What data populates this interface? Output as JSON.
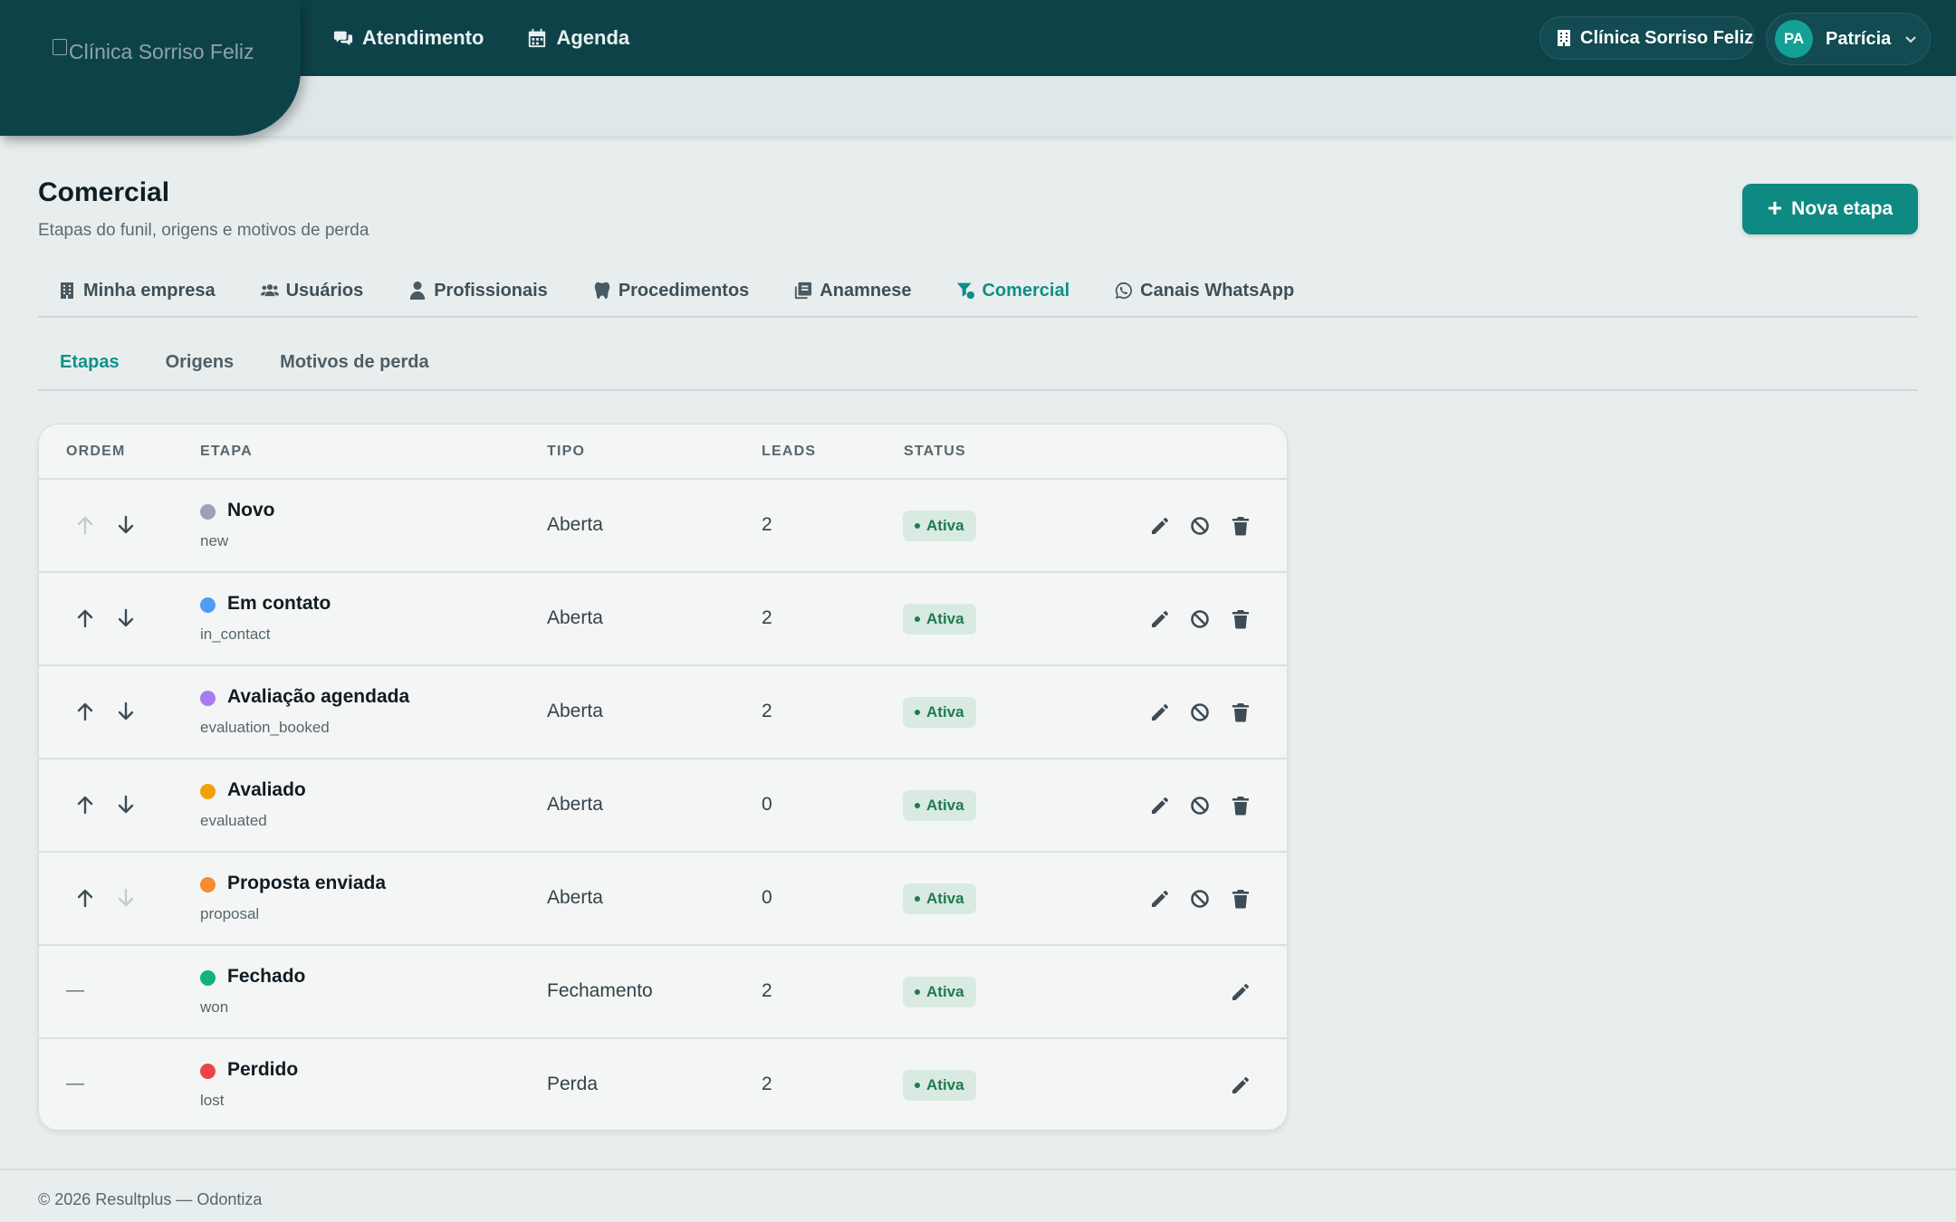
{
  "app": {
    "logo_alt": "Clínica Sorriso Feliz",
    "nav": [
      {
        "label": "Atendimento",
        "icon": "chat-bubbles-icon"
      },
      {
        "label": "Agenda",
        "icon": "calendar-icon"
      }
    ],
    "clinic_name": "Clínica Sorriso Feliz",
    "user": {
      "initials": "PA",
      "name": "Patrícia"
    }
  },
  "page": {
    "title": "Comercial",
    "subtitle": "Etapas do funil, origens e motivos de perda",
    "new_button_label": "Nova etapa"
  },
  "main_tabs": [
    {
      "label": "Minha empresa",
      "icon": "building-icon",
      "active": false
    },
    {
      "label": "Usuários",
      "icon": "users-icon",
      "active": false
    },
    {
      "label": "Profissionais",
      "icon": "doctor-icon",
      "active": false
    },
    {
      "label": "Procedimentos",
      "icon": "tooth-icon",
      "active": false
    },
    {
      "label": "Anamnese",
      "icon": "notes-icon",
      "active": false
    },
    {
      "label": "Comercial",
      "icon": "funnel-icon",
      "active": true
    },
    {
      "label": "Canais WhatsApp",
      "icon": "whatsapp-icon",
      "active": false
    }
  ],
  "sub_tabs": [
    {
      "label": "Etapas",
      "active": true
    },
    {
      "label": "Origens",
      "active": false
    },
    {
      "label": "Motivos de perda",
      "active": false
    }
  ],
  "table": {
    "headers": {
      "ordem": "ORDEM",
      "etapa": "ETAPA",
      "tipo": "TIPO",
      "leads": "LEADS",
      "status": "STATUS"
    },
    "rows": [
      {
        "name": "Novo",
        "key": "new",
        "color": "#9aa3b2",
        "tipo": "Aberta",
        "leads": "2",
        "status": "Ativa",
        "movable": true,
        "can_up": false,
        "can_down": true,
        "deletable": true
      },
      {
        "name": "Em contato",
        "key": "in_contact",
        "color": "#4f9cf5",
        "tipo": "Aberta",
        "leads": "2",
        "status": "Ativa",
        "movable": true,
        "can_up": true,
        "can_down": true,
        "deletable": true
      },
      {
        "name": "Avaliação agendada",
        "key": "evaluation_booked",
        "color": "#a77bf3",
        "tipo": "Aberta",
        "leads": "2",
        "status": "Ativa",
        "movable": true,
        "can_up": true,
        "can_down": true,
        "deletable": true
      },
      {
        "name": "Avaliado",
        "key": "evaluated",
        "color": "#f0a00c",
        "tipo": "Aberta",
        "leads": "0",
        "status": "Ativa",
        "movable": true,
        "can_up": true,
        "can_down": true,
        "deletable": true
      },
      {
        "name": "Proposta enviada",
        "key": "proposal",
        "color": "#f68c2e",
        "tipo": "Aberta",
        "leads": "0",
        "status": "Ativa",
        "movable": true,
        "can_up": true,
        "can_down": false,
        "deletable": true
      },
      {
        "name": "Fechado",
        "key": "won",
        "color": "#10b37c",
        "tipo": "Fechamento",
        "leads": "2",
        "status": "Ativa",
        "movable": false,
        "order_placeholder": "—",
        "deletable": false
      },
      {
        "name": "Perdido",
        "key": "lost",
        "color": "#ee4444",
        "tipo": "Perda",
        "leads": "2",
        "status": "Ativa",
        "movable": false,
        "order_placeholder": "—",
        "deletable": false
      }
    ]
  },
  "footer": {
    "text": "© 2026 Resultplus — Odontiza"
  }
}
